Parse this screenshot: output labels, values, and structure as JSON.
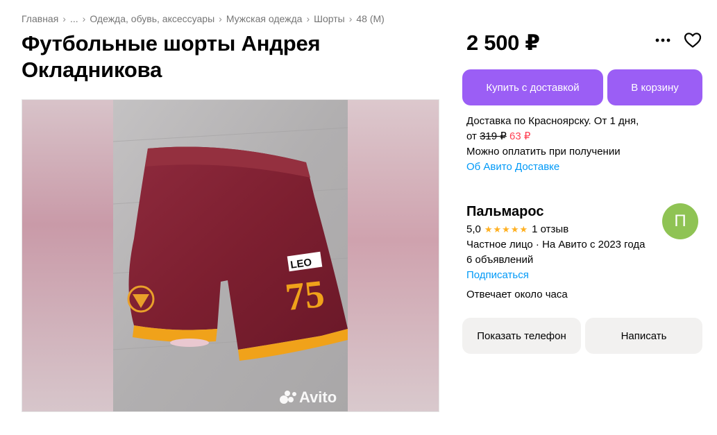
{
  "breadcrumb": {
    "items": [
      "Главная",
      "...",
      "Одежда, обувь, аксессуары",
      "Мужская одежда",
      "Шорты",
      "48 (M)"
    ],
    "separator": "›"
  },
  "listing": {
    "title": "Футбольные шорты Андрея Окладникова",
    "price": "2 500 ₽"
  },
  "photo": {
    "watermark": "Avito",
    "jersey_brand": "LEO",
    "jersey_number": "75"
  },
  "actions": {
    "buy_delivery": "Купить с доставкой",
    "add_to_cart": "В корзину",
    "more_icon": "more-dots-icon",
    "favorite_icon": "heart-icon"
  },
  "delivery": {
    "line1": "Доставка по Красноярску. От 1 дня,",
    "from_prefix": "от",
    "old_price": "319 ₽",
    "new_price": "63 ₽",
    "payment": "Можно оплатить при получении",
    "about_link": "Об Авито Доставке"
  },
  "seller": {
    "name": "Пальмарос",
    "rating": "5,0",
    "stars": "★★★★★",
    "reviews": "1 отзыв",
    "type": "Частное лицо · На Авито с 2023 года",
    "listings": "6 объявлений",
    "subscribe": "Подписаться",
    "avatar_letter": "П",
    "response_time": "Отвечает около часа"
  },
  "contact": {
    "show_phone": "Показать телефон",
    "write": "Написать"
  },
  "colors": {
    "accent": "#9b5ef5",
    "link": "#0099f7",
    "discount": "#ff4053",
    "star": "#ffb021",
    "avatar_bg": "#8fc354"
  }
}
